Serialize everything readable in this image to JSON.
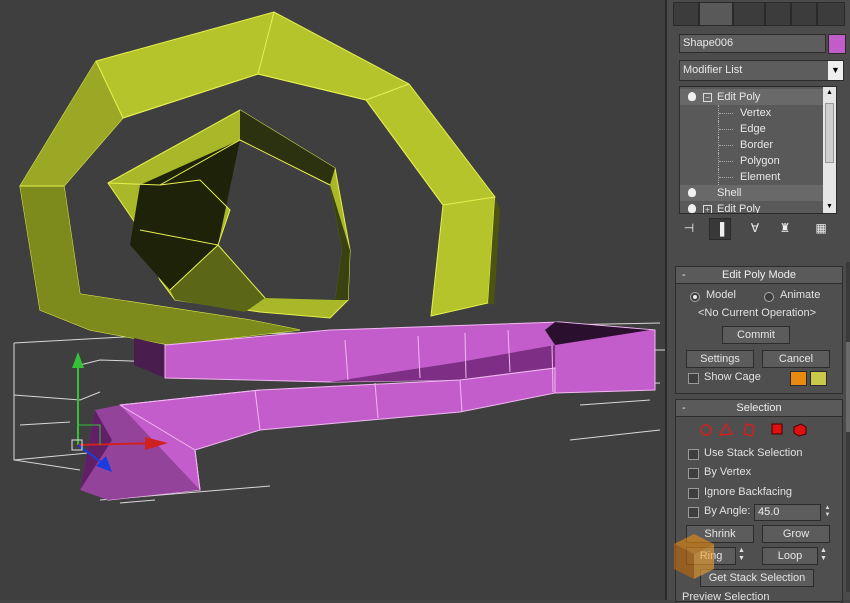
{
  "viewport": {
    "label": "",
    "colors": {
      "yellow": "#b4c42a",
      "magenta": "#c45dcc",
      "background": "#3f3f3f"
    }
  },
  "panel": {
    "object_name": "Shape006",
    "object_color": "#c35ccb",
    "modifier_list_label": "Modifier List",
    "stack": [
      {
        "label": "Edit Poly",
        "type": "modifier",
        "expanded": true
      },
      {
        "label": "Vertex",
        "type": "sub"
      },
      {
        "label": "Edge",
        "type": "sub"
      },
      {
        "label": "Border",
        "type": "sub"
      },
      {
        "label": "Polygon",
        "type": "sub"
      },
      {
        "label": "Element",
        "type": "sub"
      },
      {
        "label": "Shell",
        "type": "modifier"
      },
      {
        "label": "Edit Poly",
        "type": "modifier"
      }
    ],
    "tool_icons": [
      "pin-stack-icon",
      "show-end-result-icon",
      "make-unique-icon",
      "remove-modifier-icon",
      "configure-modifier-sets-icon"
    ]
  },
  "edit_poly_mode": {
    "title": "Edit Poly Mode",
    "model_label": "Model",
    "animate_label": "Animate",
    "mode_selected": "Model",
    "current_operation": "<No Current Operation>",
    "commit_label": "Commit",
    "settings_label": "Settings",
    "cancel_label": "Cancel",
    "show_cage_label": "Show Cage",
    "cage_colors": [
      "#e88a10",
      "#c8c84a"
    ]
  },
  "selection": {
    "title": "Selection",
    "subobject_icons": [
      "vertex-icon",
      "edge-icon",
      "border-icon",
      "polygon-icon",
      "element-icon"
    ],
    "use_stack_selection_label": "Use Stack Selection",
    "by_vertex_label": "By Vertex",
    "ignore_backfacing_label": "Ignore Backfacing",
    "by_angle_label": "By Angle:",
    "by_angle_value": "45.0",
    "shrink_label": "Shrink",
    "grow_label": "Grow",
    "ring_label": "Ring",
    "loop_label": "Loop",
    "get_stack_selection_label": "Get Stack Selection"
  },
  "preview_selection": {
    "title": "Preview Selection"
  }
}
